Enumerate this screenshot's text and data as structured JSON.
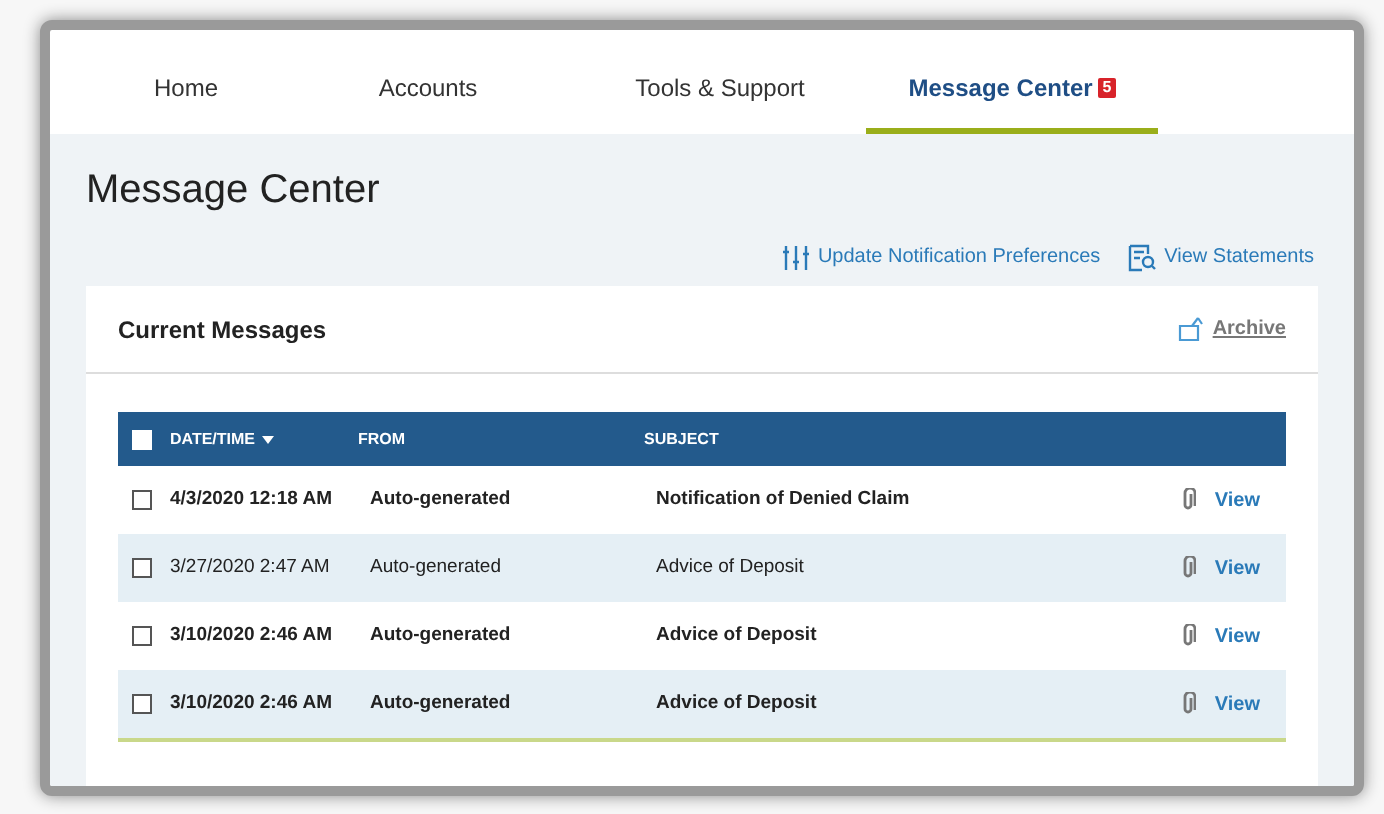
{
  "nav": {
    "tabs": [
      {
        "label": "Home",
        "selected": false
      },
      {
        "label": "Accounts",
        "selected": false
      },
      {
        "label": "Tools & Support",
        "selected": false
      },
      {
        "label": "Message Center",
        "selected": true,
        "badge": "5"
      }
    ]
  },
  "page_title": "Message Center",
  "actions": [
    {
      "kind": "preferences",
      "label": "Update Notification Preferences"
    },
    {
      "kind": "statements",
      "label": "View Statements"
    }
  ],
  "card": {
    "title": "Current Messages",
    "archive": "Archive",
    "table": {
      "select_all_checked": false,
      "columns": [
        "DATE/TIME",
        "FROM",
        "SUBJECT"
      ],
      "rows": [
        {
          "checked": false,
          "unread": true,
          "date": "4/3/2020 12:18 AM",
          "from": "Auto-generated",
          "subject": "Notification of Denied Claim",
          "action": "View"
        },
        {
          "checked": false,
          "unread": false,
          "date": "3/27/2020 2:47 AM",
          "from": "Auto-generated",
          "subject": "Advice of Deposit",
          "action": "View"
        },
        {
          "checked": false,
          "unread": true,
          "date": "3/10/2020 2:46 AM",
          "from": "Auto-generated",
          "subject": "Advice of Deposit",
          "action": "View"
        },
        {
          "checked": false,
          "unread": true,
          "date": "3/10/2020 2:46 AM",
          "from": "Auto-generated",
          "subject": "Advice of Deposit",
          "action": "View"
        }
      ]
    }
  }
}
